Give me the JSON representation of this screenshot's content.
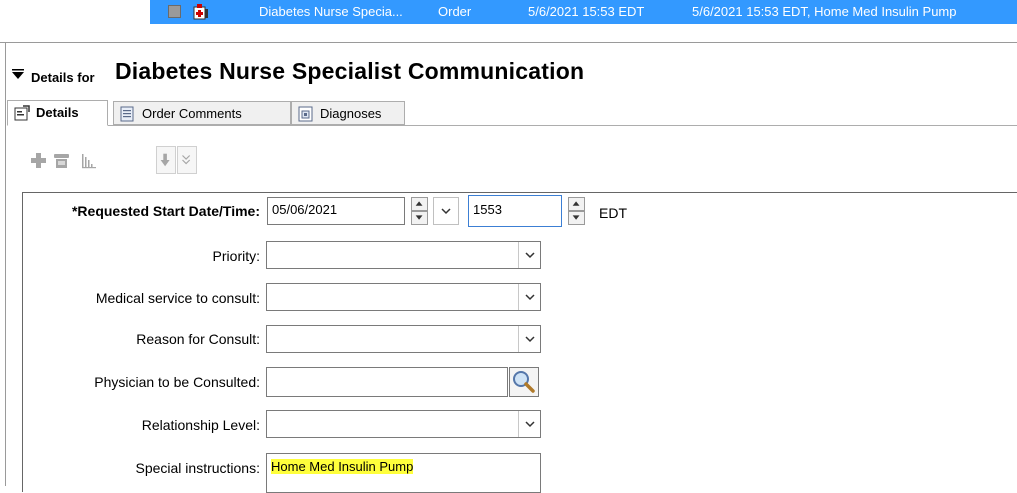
{
  "order_row": {
    "order_name": "Diabetes Nurse Specia...",
    "type": "Order",
    "start_time": "5/6/2021 15:53 EDT",
    "details": "5/6/2021 15:53 EDT, Home Med Insulin Pump"
  },
  "details_header": {
    "prefix": "Details for",
    "title": "Diabetes Nurse Specialist Communication"
  },
  "tabs": [
    {
      "label": "Details",
      "icon": "details-icon",
      "active": true
    },
    {
      "label": "Order Comments",
      "icon": "comments-icon",
      "active": false
    },
    {
      "label": "Diagnoses",
      "icon": "diagnoses-icon",
      "active": false
    }
  ],
  "toolbar": {
    "icons": [
      "add-icon",
      "phone-icon",
      "chart-icon",
      "down-arrow-icon",
      "double-chevron-icon"
    ]
  },
  "form": {
    "requested_start": {
      "label": "*Requested Start Date/Time:",
      "date": "05/06/2021",
      "time": "1553",
      "tz": "EDT"
    },
    "priority": {
      "label": "Priority:",
      "value": ""
    },
    "medical_service": {
      "label": "Medical service to consult:",
      "value": ""
    },
    "reason": {
      "label": "Reason for Consult:",
      "value": ""
    },
    "physician": {
      "label": "Physician to be Consulted:",
      "value": ""
    },
    "relationship": {
      "label": "Relationship Level:",
      "value": ""
    },
    "special": {
      "label": "Special instructions:",
      "value": "Home Med Insulin Pump"
    }
  },
  "colors": {
    "selection": "#3399ff",
    "highlight": "#ffff3c"
  }
}
